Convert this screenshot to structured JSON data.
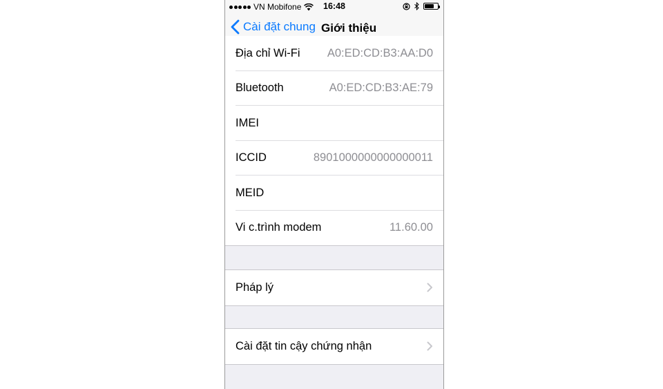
{
  "status_bar": {
    "carrier": "VN Mobifone",
    "time": "16:48",
    "battery_level": 0.7
  },
  "nav": {
    "back_label": "Cài đặt chung",
    "title": "Giới thiệu"
  },
  "info_rows": [
    {
      "label": "Địa chỉ Wi-Fi",
      "value": "A0:ED:CD:B3:AA:D0"
    },
    {
      "label": "Bluetooth",
      "value": "A0:ED:CD:B3:AE:79"
    },
    {
      "label": "IMEI",
      "value": ""
    },
    {
      "label": "ICCID",
      "value": "8901000000000000011"
    },
    {
      "label": "MEID",
      "value": ""
    },
    {
      "label": "Vi c.trình modem",
      "value": "11.60.00"
    }
  ],
  "links": {
    "legal": "Pháp lý",
    "trust_settings": "Cài đặt tin cậy chứng nhận"
  },
  "icons": [
    "signal-dots-icon",
    "wifi-icon",
    "orientation-lock-icon",
    "bluetooth-icon",
    "battery-icon",
    "back-chevron-icon",
    "chevron-right-icon"
  ],
  "colors": {
    "accent": "#0a7aff",
    "secondary_text": "#8e8e93",
    "grouped_background": "#efeff4"
  }
}
